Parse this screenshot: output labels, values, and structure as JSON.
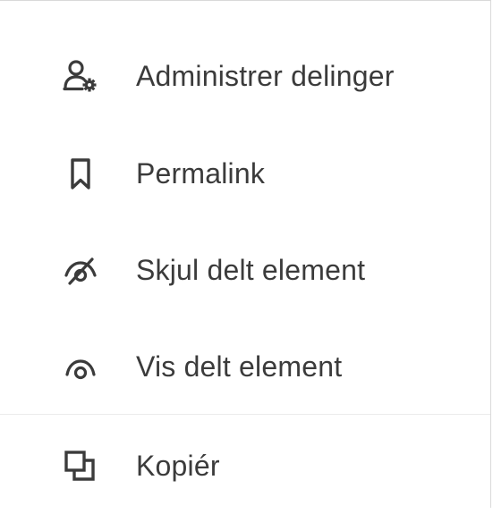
{
  "menu": {
    "items": [
      {
        "label": "Administrer delinger",
        "icon": "manage-sharing-icon"
      },
      {
        "label": "Permalink",
        "icon": "bookmark-icon"
      },
      {
        "label": "Skjul delt element",
        "icon": "eye-hidden-icon"
      },
      {
        "label": "Vis delt element",
        "icon": "eye-icon"
      },
      {
        "label": "Kopiér",
        "icon": "copy-icon"
      }
    ]
  },
  "colors": {
    "text": "#3b3b3b",
    "icon": "#3b3b3b",
    "border": "#d9d9d9",
    "divider": "#ebebeb",
    "background": "#ffffff"
  }
}
